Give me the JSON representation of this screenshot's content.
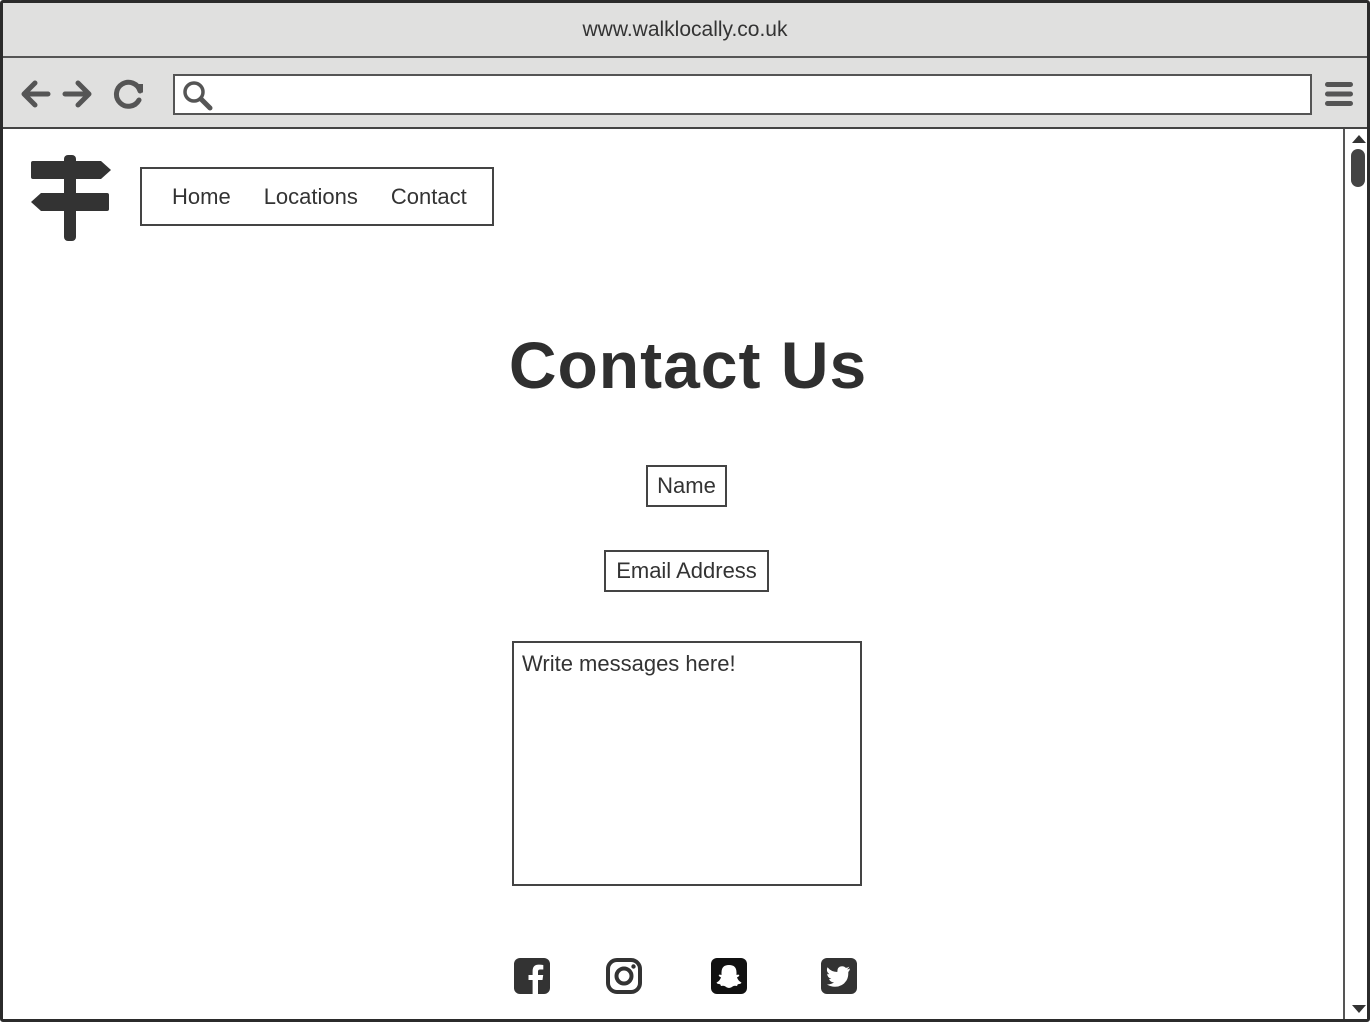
{
  "browser": {
    "url": "www.walklocally.co.uk",
    "address_value": "",
    "icons": {
      "back": "arrow-left-icon",
      "forward": "arrow-right-icon",
      "reload": "reload-icon",
      "search": "search-icon",
      "menu": "hamburger-menu-icon"
    }
  },
  "site": {
    "logo": "signpost-icon",
    "nav": {
      "items": [
        {
          "label": "Home"
        },
        {
          "label": "Locations"
        },
        {
          "label": "Contact"
        }
      ]
    }
  },
  "contact": {
    "title": "Contact Us",
    "name_placeholder": "Name",
    "email_placeholder": "Email Address",
    "message_placeholder": "Write messages here!"
  },
  "social": {
    "icons": [
      "facebook-icon",
      "instagram-icon",
      "snapchat-icon",
      "twitter-icon"
    ]
  },
  "colors": {
    "chrome": "#e0e0df",
    "ink": "#333333"
  }
}
